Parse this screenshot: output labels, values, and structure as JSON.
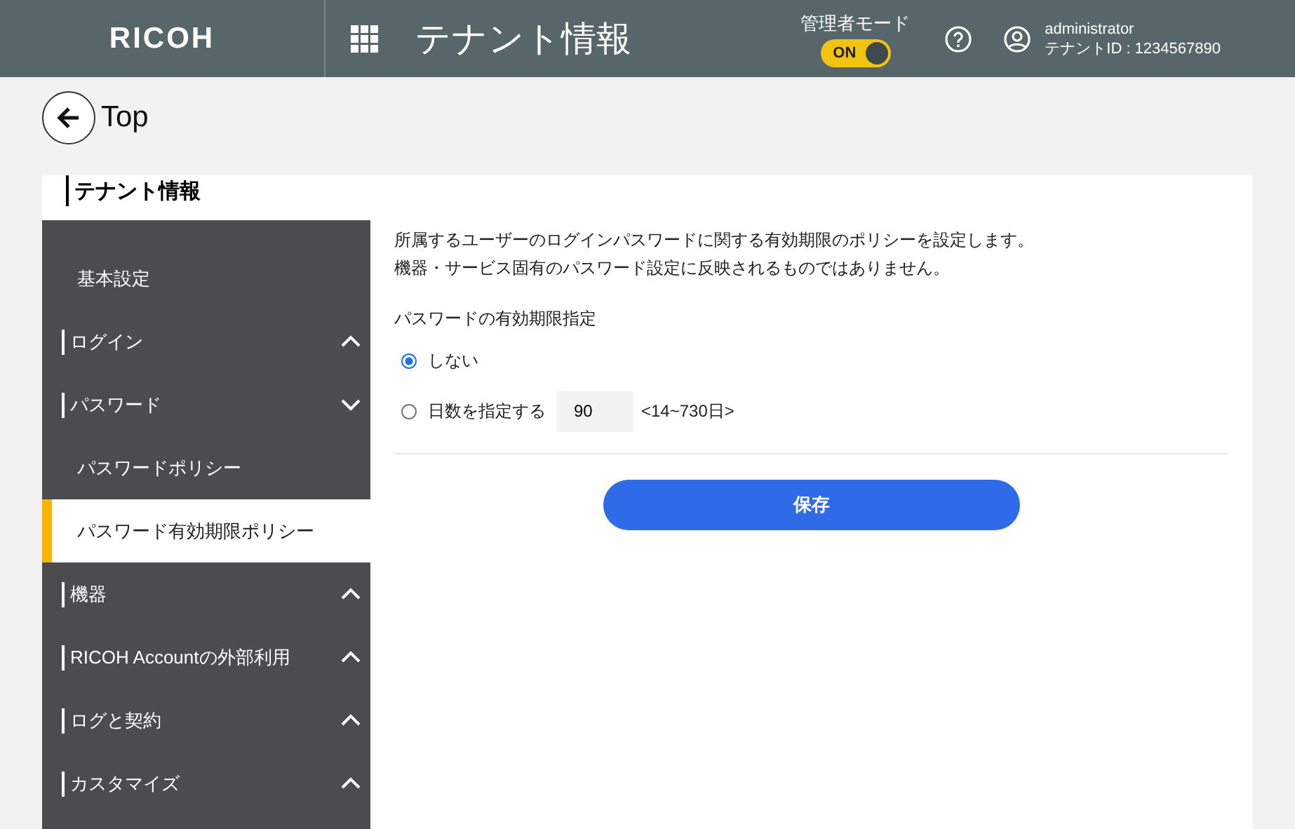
{
  "header": {
    "logo": "RICOH",
    "title": "テナント情報",
    "admin_mode": {
      "label": "管理者モード",
      "toggle_text": "ON",
      "on": true
    },
    "user": {
      "name": "administrator",
      "tenant": "テナントID : 1234567890"
    }
  },
  "back": {
    "label": "Top"
  },
  "section_title": "テナント情報",
  "sidebar": {
    "items": [
      {
        "label": "基本設定",
        "kind": "link",
        "selected": false
      },
      {
        "label": "ログイン",
        "kind": "group",
        "expanded": false
      },
      {
        "label": "パスワード",
        "kind": "group",
        "expanded": true,
        "children": [
          {
            "label": "パスワードポリシー",
            "selected": false
          },
          {
            "label": "パスワード有効期限ポリシー",
            "selected": true
          }
        ]
      },
      {
        "label": "機器",
        "kind": "group",
        "expanded": false
      },
      {
        "label": "RICOH Accountの外部利用",
        "kind": "group",
        "expanded": false
      },
      {
        "label": "ログと契約",
        "kind": "group",
        "expanded": false
      },
      {
        "label": "カスタマイズ",
        "kind": "group",
        "expanded": false
      }
    ]
  },
  "content": {
    "description": [
      "所属するユーザーのログインパスワードに関する有効期限のポリシーを設定します。",
      "機器・サービス固有のパスワード設定に反映されるものではありません。"
    ],
    "field_label": "パスワードの有効期限指定",
    "options": [
      {
        "label": "しない",
        "selected": true,
        "kind": "plain"
      },
      {
        "label": "日数を指定する",
        "selected": false,
        "kind": "days",
        "value": "90",
        "hint": "<14~730日>"
      }
    ],
    "save_button": "保存"
  }
}
